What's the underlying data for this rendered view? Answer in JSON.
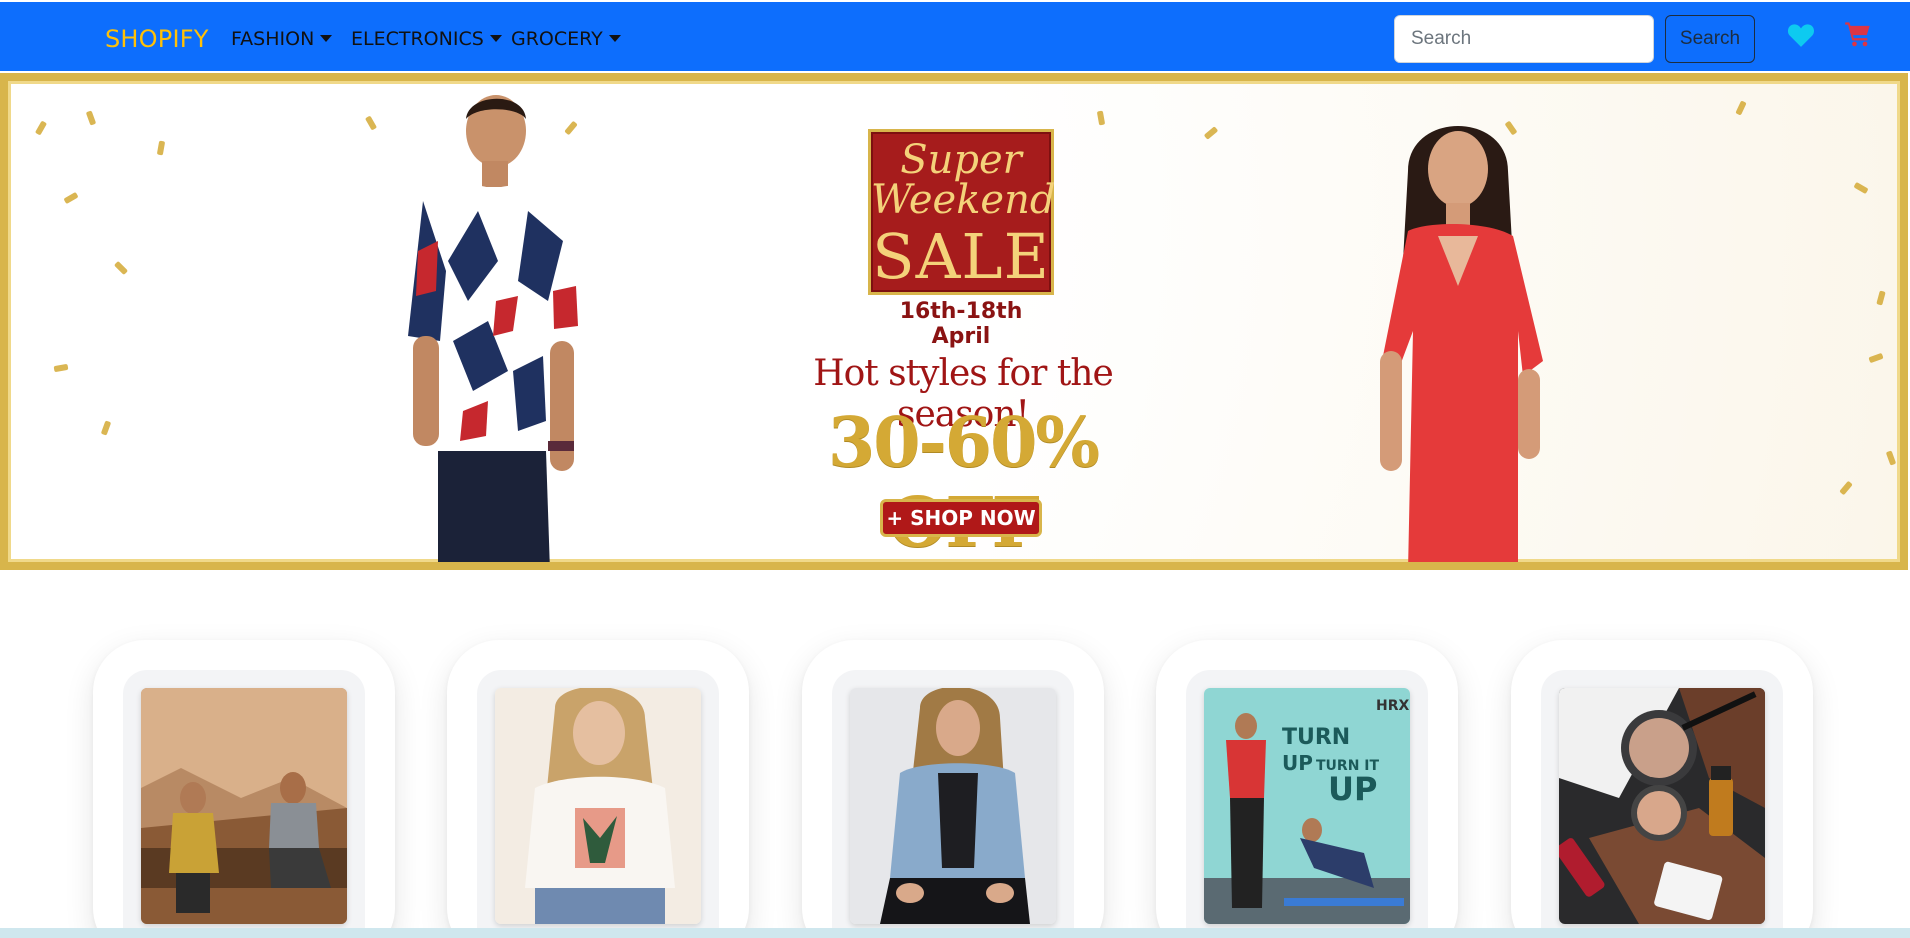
{
  "navbar": {
    "brand": "SHOPIFY",
    "menu": [
      {
        "label": "FASHION"
      },
      {
        "label": "ELECTRONICS"
      },
      {
        "label": "GROCERY"
      }
    ],
    "search": {
      "placeholder": "Search",
      "value": ""
    },
    "search_button": "Search",
    "icons": [
      "heart-icon",
      "cart-icon"
    ],
    "colors": {
      "bg": "#0d6efd",
      "brand": "#ffc107",
      "heart": "#0dcaf0",
      "cart": "#dc3545"
    }
  },
  "banner": {
    "badge_line1": "Super",
    "badge_line2": "Weekend",
    "badge_line3": "SALE",
    "dates": "16th-18th April",
    "headline": "Hot styles for the season!",
    "discount": "30-60% OFF",
    "cta": "+ SHOP NOW"
  },
  "cards": [
    {
      "image": "couple-desert-photo"
    },
    {
      "image": "tshirt-model-photo"
    },
    {
      "image": "denim-jacket-model-photo"
    },
    {
      "image": "hrx-fitness-photo",
      "text": "TURN UP TURN IT UP",
      "logo": "HRX"
    },
    {
      "image": "cosmetics-photo"
    }
  ]
}
